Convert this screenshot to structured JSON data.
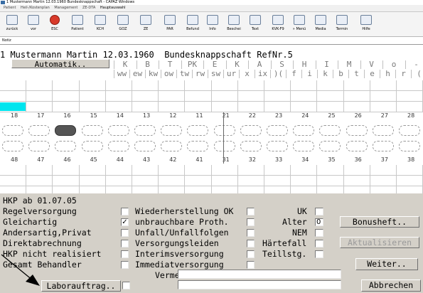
{
  "window": {
    "title": "1 Mustermann Martin 12.03.1960  Bundesknappschaft  - CAPAZ Windows"
  },
  "menu": [
    "Patient",
    "Heil-/Kostenplan",
    "Management",
    "ZE-DTA",
    "Hauptauswahl"
  ],
  "toolbar": [
    {
      "label": "zurück",
      "icon": "arrow-left-icon"
    },
    {
      "label": "vor",
      "icon": "arrow-right-icon"
    },
    {
      "label": "ESC",
      "icon": "stop-icon"
    },
    {
      "label": "Patient",
      "icon": "patient-icon"
    },
    {
      "label": "KCH",
      "icon": "kch-icon"
    },
    {
      "label": "GOZ",
      "icon": "goz-icon"
    },
    {
      "label": "ZE",
      "icon": "ze-icon"
    },
    {
      "label": "PAR",
      "icon": "par-icon"
    },
    {
      "label": "Befund",
      "icon": "befund-icon"
    },
    {
      "label": "Info",
      "icon": "info-icon"
    },
    {
      "label": "Beschei",
      "icon": "bescheid-icon"
    },
    {
      "label": "Text",
      "icon": "text-icon"
    },
    {
      "label": "KVK-F9",
      "icon": "kvk-icon"
    },
    {
      "label": "» Menü",
      "icon": "menu-icon"
    },
    {
      "label": "Media",
      "icon": "media-icon"
    },
    {
      "label": "Termin",
      "icon": "termin-icon"
    },
    {
      "label": "Hilfe",
      "icon": "help-icon"
    }
  ],
  "notiz": {
    "label": "Notiz"
  },
  "patient_line": "1 Mustermann Martin 12.03.1960  Bundesknappschaft RefNr.5",
  "automatik_button": "Automatik..",
  "header_top": [
    "K",
    "B",
    "T",
    "PK",
    "E",
    "K",
    "A",
    "S",
    "H",
    "I",
    "M",
    "V",
    "o",
    "-"
  ],
  "header_bottom": [
    "ww",
    "ew",
    "kw",
    "ow",
    "tw",
    "rw",
    "sw",
    "ur",
    "x",
    "ix",
    ")(",
    "f",
    "i",
    "k",
    "b",
    "t",
    "e",
    "h",
    "r",
    "("
  ],
  "teeth_upper": [
    "18",
    "17",
    "16",
    "15",
    "14",
    "13",
    "12",
    "11",
    "21",
    "22",
    "23",
    "24",
    "25",
    "26",
    "27",
    "28"
  ],
  "teeth_lower": [
    "48",
    "47",
    "46",
    "45",
    "44",
    "43",
    "42",
    "41",
    "31",
    "32",
    "33",
    "34",
    "35",
    "36",
    "37",
    "38"
  ],
  "highlight_color": "#00e5ee",
  "hkp": {
    "title": "HKP ab 01.07.05",
    "col1": [
      {
        "label": "Regelversorgung",
        "checked": ""
      },
      {
        "label": "Gleichartig",
        "checked": "✓"
      },
      {
        "label": "Andersartig,Privat",
        "checked": ""
      },
      {
        "label": "Direktabrechnung",
        "checked": ""
      },
      {
        "label": "HKP nicht realisiert",
        "checked": ""
      },
      {
        "label": "Gesamt Behandler",
        "checked": ""
      }
    ],
    "col2": [
      {
        "label": "Wiederherstellung OK",
        "checked": ""
      },
      {
        "label": "unbrauchbare Proth.",
        "checked": ""
      },
      {
        "label": "Unfall/Unfallfolgen",
        "checked": ""
      },
      {
        "label": "Versorgungsleiden",
        "checked": ""
      },
      {
        "label": "Interimsversorgung",
        "checked": ""
      },
      {
        "label": "Immediatversorgung",
        "checked": ""
      }
    ],
    "col3": [
      {
        "label": "UK",
        "value": ""
      },
      {
        "label": "Alter",
        "value": "0"
      },
      {
        "label": "NEM",
        "value": ""
      },
      {
        "label": "Härtefall",
        "value": ""
      },
      {
        "label": "Teillstg.",
        "value": ""
      }
    ],
    "vermerk_label": "Vermerk"
  },
  "buttons": {
    "bonusheft": "Bonusheft..",
    "aktualisieren": "Aktualisieren",
    "weiter": "Weiter..",
    "laborauftrag": "Laborauftrag..",
    "abbrechen": "Abbrechen"
  }
}
